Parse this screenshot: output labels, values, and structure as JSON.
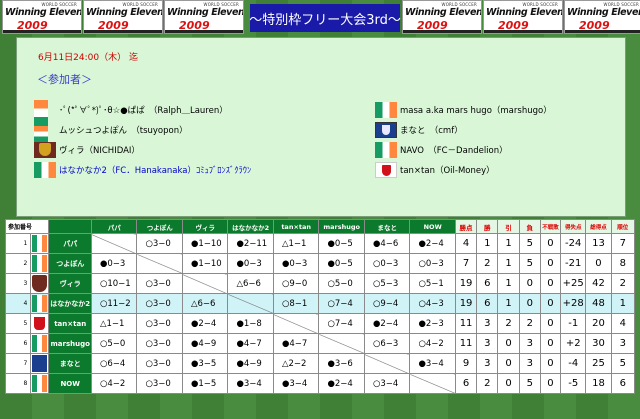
{
  "header": {
    "logo_small": "WORLD SOCCER",
    "logo_text": "Winning Eleven.",
    "logo_year": "2009",
    "title": "～特別枠フリー大会3rd～"
  },
  "info": {
    "deadline": "6月11日24:00（木） 迄",
    "participants_label": "＜参加者＞",
    "participants_left": [
      {
        "text": "･ﾟ(*ﾟ∀ﾟ*)ﾟ･θ☆●ぱぱ　（Ralph＿Lauren）",
        "color": "#000000"
      },
      {
        "text": "ムッシュつよぽん　（tsuyopon）",
        "color": "#000000"
      },
      {
        "text": "ヴィラ（NICHIDAI）",
        "color": "#000000"
      },
      {
        "text": "はなかなか2（FC．Hanakanaka）ｺﾐｭﾌﾞﾛﾝｽﾞｸﾗｳﾝ",
        "color": "#0000cc"
      }
    ],
    "participants_right": [
      {
        "text": "masa a.ka mars hugo（marshugo）",
        "color": "#000000"
      },
      {
        "text": "まなと　（cmf）",
        "color": "#000000"
      },
      {
        "text": "NAVO　（FC－Dandelion）",
        "color": "#000000"
      },
      {
        "text": "tan×tan（Oil-Money）",
        "color": "#000000"
      }
    ]
  },
  "table": {
    "corner": "参加番号",
    "teams": [
      "パパ",
      "つよぽん",
      "ヴィラ",
      "はなかなか2",
      "tan×tan",
      "marshugo",
      "まなと",
      "NOW"
    ],
    "stat_headers": [
      "勝点",
      "勝",
      "引",
      "負",
      "不戦敗",
      "得失点",
      "総得点",
      "順位"
    ],
    "rows": [
      {
        "num": "1",
        "name": "パパ",
        "results": [
          "",
          "○3−0",
          "●1−10",
          "●2−11",
          "△1−1",
          "●0−5",
          "●4−6",
          "●2−4"
        ],
        "stats": [
          "4",
          "1",
          "1",
          "5",
          "0",
          "-24",
          "13",
          "7"
        ]
      },
      {
        "num": "2",
        "name": "つよぽん",
        "results": [
          "●0−3",
          "",
          "●1−10",
          "●0−3",
          "●0−3",
          "●0−5",
          "○0−3",
          "○0−3"
        ],
        "stats": [
          "7",
          "2",
          "1",
          "5",
          "0",
          "-21",
          "0",
          "8"
        ]
      },
      {
        "num": "3",
        "name": "ヴィラ",
        "results": [
          "○10−1",
          "○3−0",
          "",
          "△6−6",
          "○9−0",
          "○5−0",
          "○5−3",
          "○5−1"
        ],
        "stats": [
          "19",
          "6",
          "1",
          "0",
          "0",
          "+25",
          "42",
          "2"
        ]
      },
      {
        "num": "4",
        "name": "はなかなか2",
        "results": [
          "○11−2",
          "○3−0",
          "△6−6",
          "",
          "○8−1",
          "○7−4",
          "○9−4",
          "○4−3"
        ],
        "stats": [
          "19",
          "6",
          "1",
          "0",
          "0",
          "+28",
          "48",
          "1"
        ]
      },
      {
        "num": "5",
        "name": "tan×tan",
        "results": [
          "△1−1",
          "○3−0",
          "●2−4",
          "●1−8",
          "",
          "○7−4",
          "●2−4",
          "●2−3"
        ],
        "stats": [
          "11",
          "3",
          "2",
          "2",
          "0",
          "-1",
          "20",
          "4"
        ]
      },
      {
        "num": "6",
        "name": "marshugo",
        "results": [
          "○5−0",
          "○3−0",
          "●4−9",
          "●4−7",
          "●4−7",
          "",
          "○6−3",
          "○4−2"
        ],
        "stats": [
          "11",
          "3",
          "0",
          "3",
          "0",
          "+2",
          "30",
          "3"
        ]
      },
      {
        "num": "7",
        "name": "まなと",
        "results": [
          "○6−4",
          "○3−0",
          "●3−5",
          "●4−9",
          "△2−2",
          "●3−6",
          "",
          "●3−4"
        ],
        "stats": [
          "9",
          "3",
          "0",
          "3",
          "0",
          "-4",
          "25",
          "5"
        ]
      },
      {
        "num": "8",
        "name": "NOW",
        "results": [
          "○4−2",
          "○3−0",
          "●1−5",
          "●3−4",
          "●3−4",
          "●2−4",
          "○3−4",
          ""
        ],
        "stats": [
          "6",
          "2",
          "0",
          "5",
          "0",
          "-5",
          "18",
          "6"
        ]
      }
    ],
    "icons": [
      "irl",
      "irl",
      "crest",
      "irl",
      "sev",
      "irl",
      "ire",
      "irl"
    ]
  },
  "colors": {
    "accent": "#0b7a2c",
    "title_bg": "#1a1aa8",
    "panel_bg": "#d9f7d7",
    "highlight_row": "#d0f3f8"
  }
}
